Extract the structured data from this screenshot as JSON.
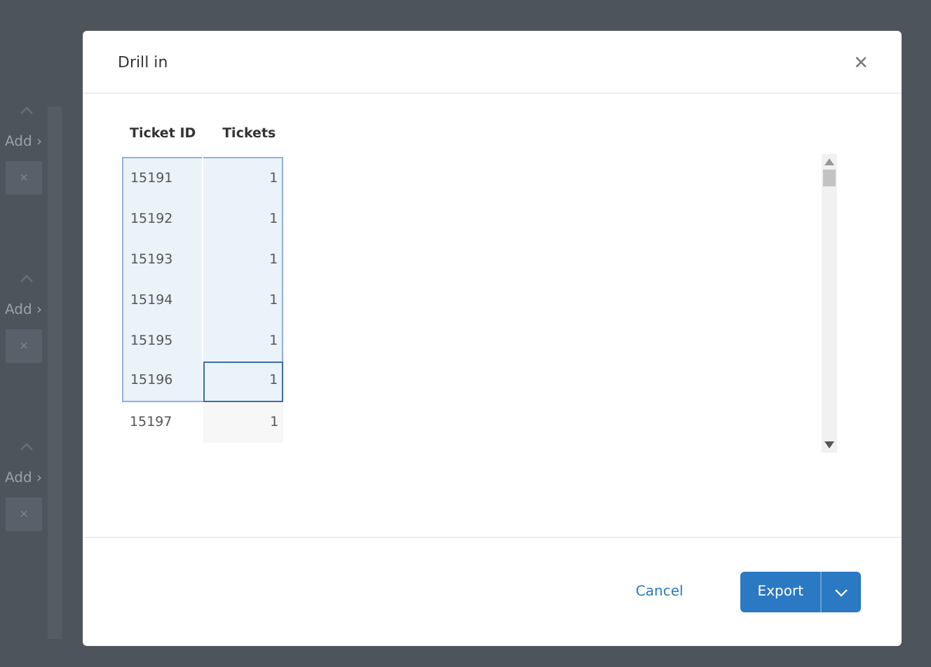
{
  "background": {
    "groups": [
      {
        "add_label": "Add ›",
        "remove_label": "×"
      },
      {
        "add_label": "Add ›",
        "remove_label": "×"
      },
      {
        "add_label": "Add ›",
        "remove_label": "×"
      }
    ]
  },
  "dialog": {
    "title": "Drill in",
    "close_label": "×",
    "table": {
      "columns": [
        "Ticket ID",
        "Tickets"
      ],
      "rows": [
        {
          "cells": [
            "15191",
            "1"
          ],
          "selected": true,
          "focused": false
        },
        {
          "cells": [
            "15192",
            "1"
          ],
          "selected": true,
          "focused": false
        },
        {
          "cells": [
            "15193",
            "1"
          ],
          "selected": true,
          "focused": false
        },
        {
          "cells": [
            "15194",
            "1"
          ],
          "selected": true,
          "focused": false
        },
        {
          "cells": [
            "15195",
            "1"
          ],
          "selected": true,
          "focused": false
        },
        {
          "cells": [
            "15196",
            "1"
          ],
          "selected": true,
          "focused": true
        },
        {
          "cells": [
            "15197",
            "1"
          ],
          "selected": false,
          "focused": false
        }
      ]
    },
    "buttons": {
      "cancel": "Cancel",
      "export": "Export"
    }
  }
}
